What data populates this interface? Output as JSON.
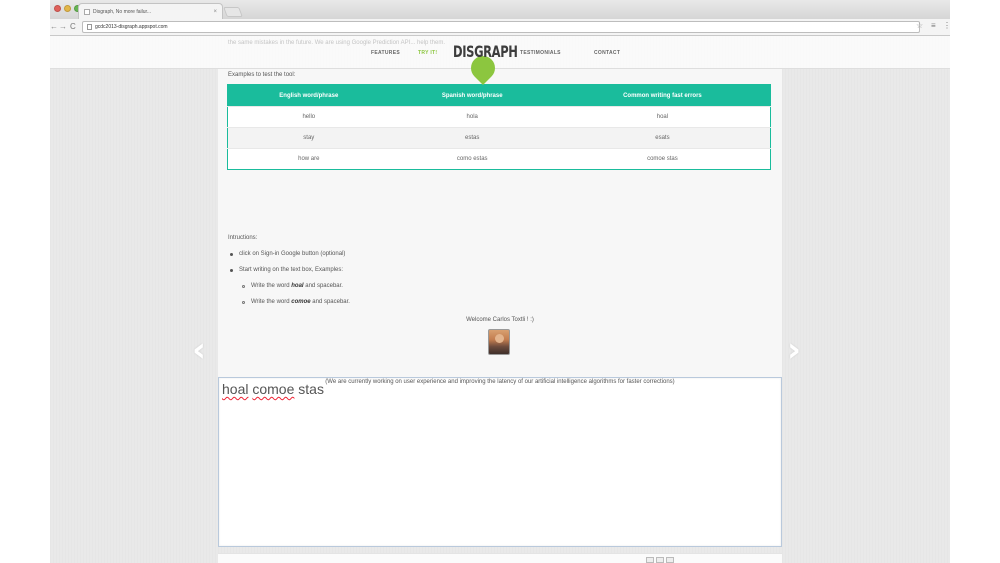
{
  "browser": {
    "tab_title": "Disgraph, No more failur...",
    "tab_close": "×",
    "url": "gcdc2013-disgraph.appspot.com",
    "back_glyph": "←",
    "forward_glyph": "→",
    "reload_glyph": "C",
    "star_glyph": "☆",
    "menu_glyph": "≡",
    "extra_glyph": "⋮"
  },
  "header": {
    "faded_text": "the same mistakes in the future. We are using Google Prediction API... help them.",
    "nav": {
      "features": "FEATURES",
      "try_it": "TRY IT!",
      "testimonials": "TESTIMONIALS",
      "contact": "CONTACT"
    },
    "logo": "DISGRAPH"
  },
  "examples": {
    "label": "Examples to test the tool:",
    "headers": [
      "English word/phrase",
      "Spanish word/phrase",
      "Common writing fast errors"
    ],
    "rows": [
      [
        "hello",
        "hola",
        "hoal"
      ],
      [
        "stay",
        "estas",
        "esats"
      ],
      [
        "how are",
        "como estas",
        "comoe stas"
      ]
    ]
  },
  "instructions": {
    "title": "Intructions:",
    "step1": "click on Sign-in Google button (optional)",
    "step2": "Start writing on the text box, Examples:",
    "sub1_prefix": "Write the word ",
    "sub1_word": "hoal",
    "sub1_suffix": " and spacebar.",
    "sub2_prefix": "Write the word ",
    "sub2_word": "comoe",
    "sub2_suffix": " and spacebar."
  },
  "welcome": "Welcome Carlos Toxtli ! :)",
  "notice": "(We are currently working on user experience and improving the latency of our artificial intelligence algorithms for faster corrections)",
  "slider": {
    "prev": "‹",
    "next": "›"
  },
  "editor": {
    "words": [
      "hoal",
      "comoe",
      "stas"
    ]
  },
  "colors": {
    "accent": "#1abc9c",
    "brand_green": "#8cc63f"
  }
}
